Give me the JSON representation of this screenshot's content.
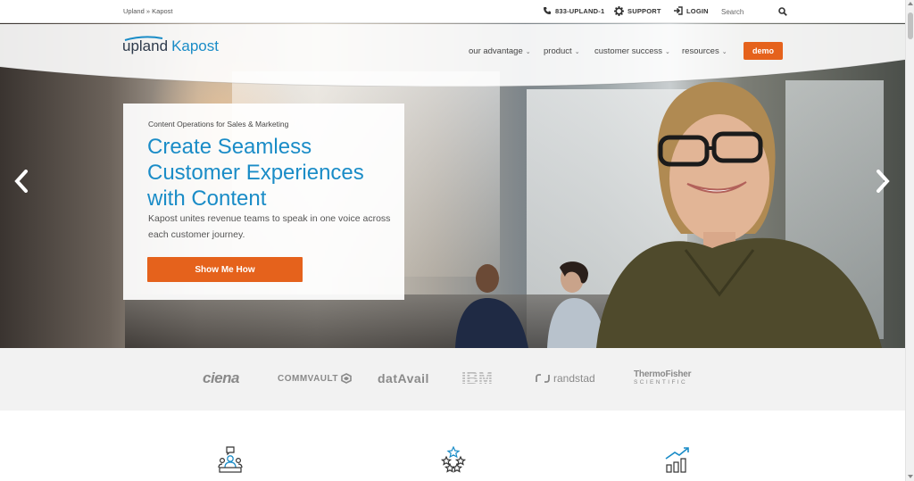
{
  "breadcrumb": {
    "parent": "Upland",
    "separator": "»",
    "current": "Kapost"
  },
  "utility": {
    "phone": "833-UPLAND-1",
    "support": "SUPPORT",
    "login": "LOGIN",
    "search_placeholder": "Search"
  },
  "brand": {
    "upland": "upland",
    "kapost": "Kapost"
  },
  "nav": {
    "items": [
      {
        "label": "our advantage"
      },
      {
        "label": "product"
      },
      {
        "label": "customer success"
      },
      {
        "label": "resources"
      }
    ],
    "demo_label": "demo"
  },
  "hero": {
    "eyebrow": "Content Operations for Sales & Marketing",
    "title": "Create Seamless Customer Experiences with Content",
    "description": "Kapost unites revenue teams to speak in one voice across each customer journey.",
    "cta_label": "Show Me How"
  },
  "client_logos": {
    "ciena": "ciena",
    "commvault": "COMMVAULT",
    "datavail": "datAvail",
    "ibm": "IBM",
    "randstad": "randstad",
    "thermo_line1": "ThermoFisher",
    "thermo_line2": "SCIENTIFIC"
  },
  "feature_icons": [
    "team-chat-icon",
    "stars-rating-icon",
    "growth-chart-icon"
  ],
  "colors": {
    "accent_blue": "#1a8cc7",
    "cta_orange": "#e5621c",
    "logo_gray": "#8a8a8a"
  }
}
